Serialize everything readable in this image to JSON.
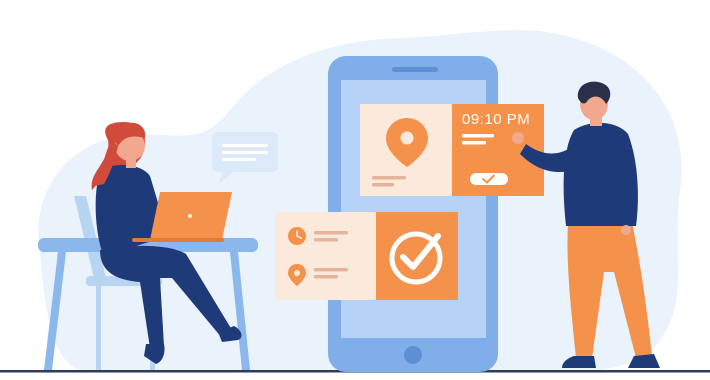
{
  "illustration": {
    "card_time": "09:10 PM",
    "icons": {
      "location_pin": "location-pin-icon",
      "clock": "clock-icon",
      "checkmark": "checkmark-icon",
      "chat_bubble": "chat-bubble-icon"
    },
    "colors": {
      "background_blob": "#eaf2fb",
      "phone_frame": "#7faee8",
      "phone_screen": "#b4d3f7",
      "orange": "#f4924b",
      "card_cream": "#fbeadb",
      "navy": "#1f3a78",
      "desk": "#8ab7ec",
      "hair_red": "#d14b3b",
      "hair_dark": "#2b2f4a",
      "skin": "#f2a88f",
      "floor": "#2f3a5c"
    }
  }
}
